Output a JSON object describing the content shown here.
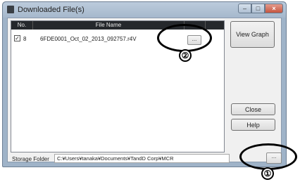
{
  "window": {
    "title": "Downloaded File(s)",
    "controls": {
      "minimize": "–",
      "maximize": "□",
      "close": "×"
    }
  },
  "table": {
    "columns": [
      "No.",
      "File Name",
      ""
    ],
    "rows": [
      {
        "checked": true,
        "check_glyph": "✓",
        "no": "8",
        "file_name": "6FDE0001_Oct_02_2013_092757.r4V",
        "button_label": "..."
      }
    ]
  },
  "buttons": {
    "view_graph": "View Graph",
    "close": "Close",
    "help": "Help",
    "browse": "..."
  },
  "storage": {
    "label": "Storage Folder",
    "path": "C:¥Users¥tanaka¥Documents¥TandD Corp¥MCR"
  },
  "annotations": {
    "marker_1": "①",
    "marker_2": "②"
  }
}
